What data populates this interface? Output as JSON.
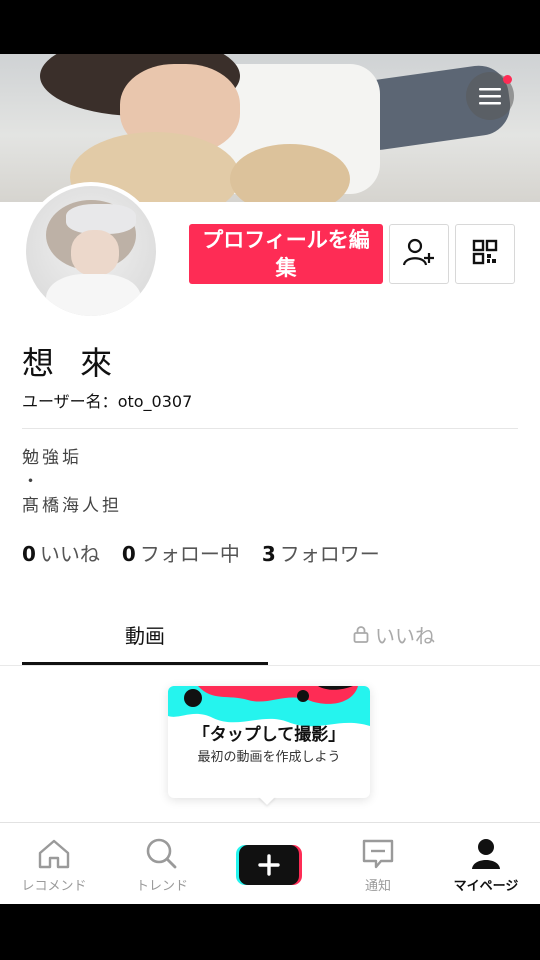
{
  "colors": {
    "brand_red": "#fe2c55",
    "brand_cyan": "#25f4ee",
    "text_primary": "#111111",
    "text_muted": "#9a9a9a"
  },
  "header": {
    "menu_icon": "hamburger-menu-icon",
    "has_notification_dot": true
  },
  "profile": {
    "display_name": "想 來",
    "username_label": "ユーザー名：",
    "username": "oto_0307",
    "edit_button_label": "プロフィールを編集",
    "add_friend_icon": "add-user-icon",
    "qr_icon": "qr-code-icon",
    "bio_lines": [
      "勉強垢",
      "・",
      "髙橋海人担"
    ],
    "stats": [
      {
        "count": "0",
        "label": "いいね"
      },
      {
        "count": "0",
        "label": "フォロー中"
      },
      {
        "count": "3",
        "label": "フォロワー"
      }
    ]
  },
  "tabs": {
    "videos_label": "動画",
    "likes_label": "いいね",
    "likes_lock_icon": "lock-icon"
  },
  "tap_card": {
    "title": "「タップして撮影」",
    "subtitle": "最初の動画を作成しよう"
  },
  "bottom_nav": {
    "items": [
      {
        "label": "レコメンド",
        "icon": "home-icon"
      },
      {
        "label": "トレンド",
        "icon": "search-icon"
      },
      {
        "label": "",
        "icon": "plus-icon"
      },
      {
        "label": "通知",
        "icon": "message-icon"
      },
      {
        "label": "マイページ",
        "icon": "profile-icon"
      }
    ],
    "active_index": 4
  }
}
